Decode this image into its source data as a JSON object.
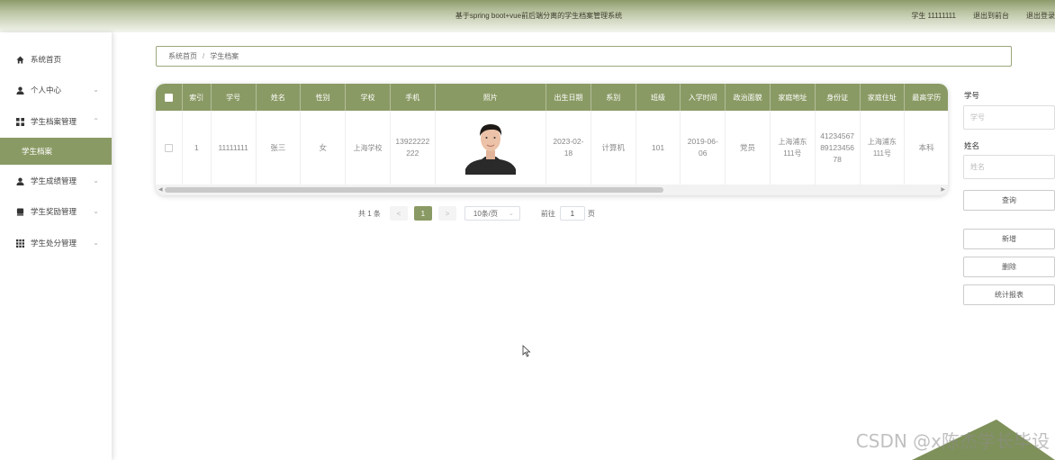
{
  "app": {
    "title": "基于spring boot+vue前后端分离的学生档案管理系统",
    "user_label": "学生 11111111",
    "back_to_front": "退出到前台",
    "logout": "退出登录"
  },
  "sidebar": {
    "items": [
      {
        "label": "系统首页",
        "icon": "home-icon"
      },
      {
        "label": "个人中心",
        "icon": "user-icon"
      },
      {
        "label": "学生档案管理",
        "icon": "grid-icon"
      },
      {
        "label": "学生档案",
        "active": true
      },
      {
        "label": "学生成绩管理",
        "icon": "user-icon"
      },
      {
        "label": "学生奖励管理",
        "icon": "book-icon"
      },
      {
        "label": "学生处分管理",
        "icon": "apps-icon"
      }
    ]
  },
  "breadcrumb": {
    "home": "系统首页",
    "sep": "/",
    "current": "学生档案"
  },
  "table": {
    "headers": [
      "索引",
      "学号",
      "姓名",
      "性别",
      "学校",
      "手机",
      "照片",
      "出生日期",
      "系别",
      "班级",
      "入学时间",
      "政治面貌",
      "家庭地址",
      "身份证",
      "家庭住址",
      "最高学历"
    ],
    "rows": [
      {
        "index": "1",
        "xuehao": "11111111",
        "name": "张三",
        "gender": "女",
        "school": "上海学校",
        "phone": "13922222222",
        "birth": "2023-02-18",
        "dept": "计算机",
        "class": "101",
        "enroll": "2019-06-06",
        "politics": "党员",
        "address": "上海浦东111号",
        "idcard": "412345678912345678",
        "home": "上海浦东111号",
        "edu": "本科"
      }
    ]
  },
  "pager": {
    "total": "共 1 条",
    "prev": "<",
    "page": "1",
    "next": ">",
    "size": "10条/页",
    "goto": "前往",
    "goto_value": "1",
    "page_unit": "页"
  },
  "search": {
    "xuehao_label": "学号",
    "xuehao_placeholder": "学号",
    "name_label": "姓名",
    "name_placeholder": "姓名",
    "query": "查询",
    "add": "新增",
    "delete": "删除",
    "report": "统计报表"
  },
  "watermark": "CSDN @x陈杰学长毕设",
  "colors": {
    "accent": "#8a9a64"
  }
}
